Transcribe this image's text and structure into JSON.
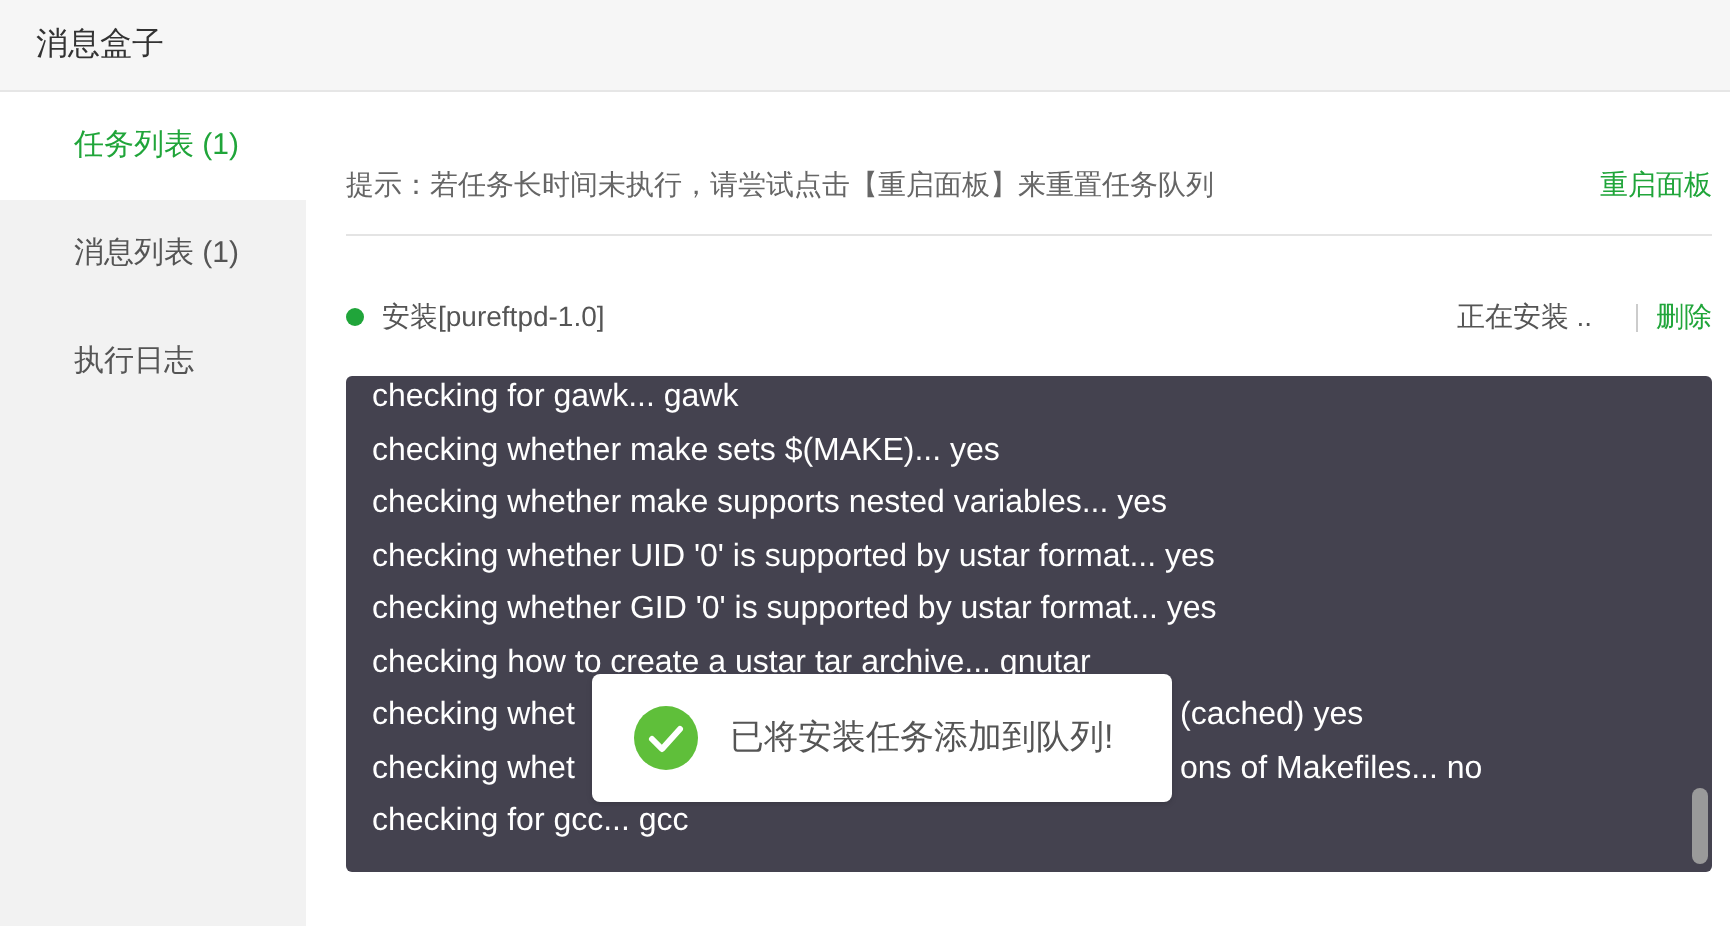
{
  "window": {
    "title": "消息盒子"
  },
  "sidebar": {
    "items": [
      {
        "label": "任务列表 (1)",
        "selected": true
      },
      {
        "label": "消息列表 (1)",
        "selected": false
      },
      {
        "label": "执行日志",
        "selected": false
      }
    ]
  },
  "hint": {
    "text": "提示：若任务长时间未执行，请尝试点击【重启面板】来重置任务队列",
    "action": "重启面板"
  },
  "task": {
    "name": "安装[pureftpd-1.0]",
    "color": "#20a53a",
    "status": "正在安装 ..",
    "action": "删除"
  },
  "log": [
    {
      "segments": [
        "checking for gawk... gawk"
      ]
    },
    {
      "segments": [
        "checking whether make sets $(MAKE)... yes"
      ]
    },
    {
      "segments": [
        "checking whether make supports nested variables... yes"
      ]
    },
    {
      "segments": [
        "checking whether UID '0' is supported by ustar format... yes"
      ]
    },
    {
      "segments": [
        "checking whether GID '0' is supported by ustar format... yes"
      ]
    },
    {
      "segments": [
        "checking how to create a ustar tar archive... gnutar"
      ]
    },
    {
      "segments": [
        "checking whet",
        "(cached) yes"
      ]
    },
    {
      "segments": [
        "checking whet",
        "ons of Makefiles... no"
      ]
    },
    {
      "segments": [
        "checking for gcc... gcc"
      ]
    }
  ],
  "toast": {
    "message": "已将安装任务添加到队列!"
  }
}
